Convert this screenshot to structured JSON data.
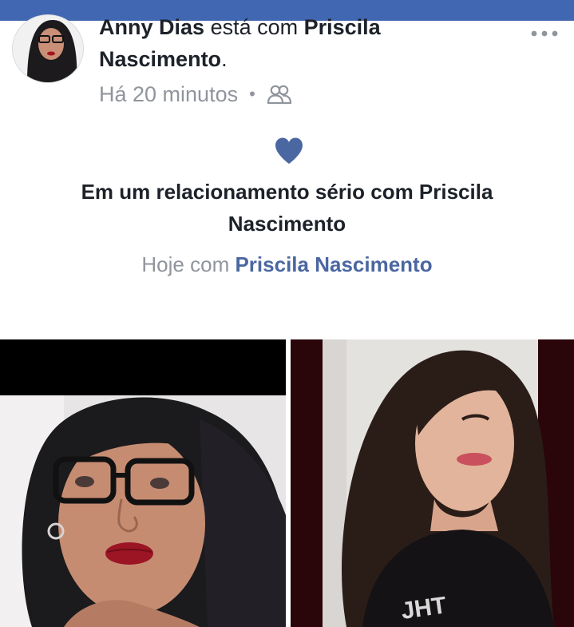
{
  "post": {
    "author_name": "Anny Dias",
    "with_text": "está com",
    "tagged_name": "Priscila Nascimento",
    "period": ".",
    "timestamp": "Há 20 minutos",
    "separator": "•",
    "audience_icon": "friends-icon",
    "more_icon": "more-options-icon"
  },
  "life_event": {
    "icon": "heart-icon",
    "title": "Em um relacionamento sério com Priscila Nascimento",
    "date_prefix": "Hoje com",
    "partner_name": "Priscila Nascimento"
  },
  "colors": {
    "accent": "#4267b2",
    "heart": "#4b67a1",
    "link": "#4b67a1",
    "meta_text": "#90949c",
    "body_text": "#1d2129"
  }
}
